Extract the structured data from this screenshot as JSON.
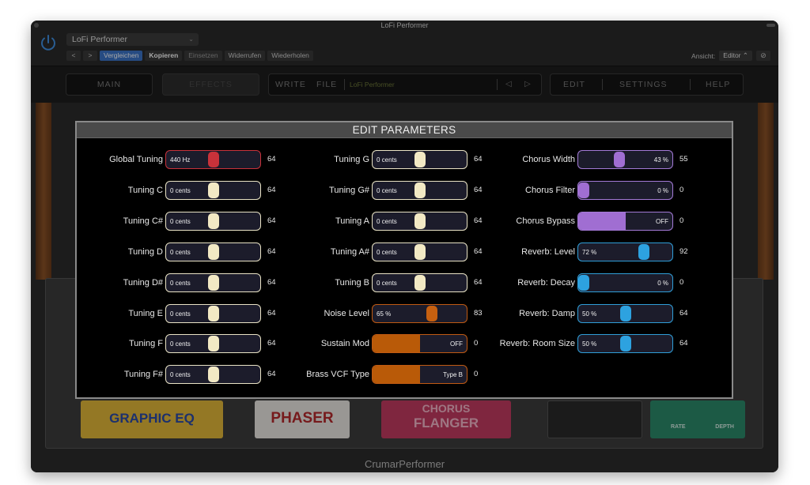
{
  "window": {
    "title": "LoFi Performer"
  },
  "host_toolbar": {
    "preset_name": "LoFi Performer",
    "prev_label": "<",
    "next_label": ">",
    "compare_label": "Vergleichen",
    "copy_label": "Kopieren",
    "paste_label": "Einsetzen",
    "undo_label": "Widerrufen",
    "redo_label": "Wiederholen",
    "view_label": "Ansicht:",
    "view_value": "Editor"
  },
  "plugin_nav": {
    "main": "MAIN",
    "effects": "EFFECTS",
    "write": "WRITE",
    "file": "FILE",
    "preset": "LoFi Performer",
    "edit": "EDIT",
    "settings": "SETTINGS",
    "help": "HELP"
  },
  "pedals": {
    "graphic_eq": "GRAPHIC EQ",
    "phaser": "PHASER",
    "chorus_flanger_1": "CHORUS",
    "chorus_flanger_2": "FLANGER",
    "rate": "RATE",
    "depth": "DEPTH"
  },
  "footer": {
    "brand": "CrumarPerformer"
  },
  "modal": {
    "title": "EDIT PARAMETERS",
    "columns": [
      [
        {
          "label": "Global Tuning",
          "display": "440 Hz",
          "value": "64",
          "level": 0.5,
          "color": "red"
        },
        {
          "label": "Tuning C",
          "display": "0 cents",
          "value": "64",
          "level": 0.5,
          "color": "cream"
        },
        {
          "label": "Tuning C#",
          "display": "0 cents",
          "value": "64",
          "level": 0.5,
          "color": "cream"
        },
        {
          "label": "Tuning D",
          "display": "0 cents",
          "value": "64",
          "level": 0.5,
          "color": "cream"
        },
        {
          "label": "Tuning D#",
          "display": "0 cents",
          "value": "64",
          "level": 0.5,
          "color": "cream"
        },
        {
          "label": "Tuning E",
          "display": "0 cents",
          "value": "64",
          "level": 0.5,
          "color": "cream"
        },
        {
          "label": "Tuning F",
          "display": "0 cents",
          "value": "64",
          "level": 0.5,
          "color": "cream"
        },
        {
          "label": "Tuning F#",
          "display": "0 cents",
          "value": "64",
          "level": 0.5,
          "color": "cream"
        }
      ],
      [
        {
          "label": "Tuning G",
          "display": "0 cents",
          "value": "64",
          "level": 0.5,
          "color": "cream"
        },
        {
          "label": "Tuning G#",
          "display": "0 cents",
          "value": "64",
          "level": 0.5,
          "color": "cream"
        },
        {
          "label": "Tuning A",
          "display": "0 cents",
          "value": "64",
          "level": 0.5,
          "color": "cream"
        },
        {
          "label": "Tuning A#",
          "display": "0 cents",
          "value": "64",
          "level": 0.5,
          "color": "cream"
        },
        {
          "label": "Tuning B",
          "display": "0 cents",
          "value": "64",
          "level": 0.5,
          "color": "cream"
        },
        {
          "label": "Noise Level",
          "display": "65 %",
          "value": "83",
          "level": 0.65,
          "color": "orange"
        },
        {
          "label": "Sustain Mod",
          "display": "OFF",
          "value": "0",
          "level": 0,
          "color": "orange",
          "toggle": true
        },
        {
          "label": "Brass VCF Type",
          "display": "Type B",
          "value": "0",
          "level": 0,
          "color": "orange",
          "toggle": true
        }
      ],
      [
        {
          "label": "Chorus Width",
          "display": "43 %",
          "value": "55",
          "level": 0.43,
          "color": "purple"
        },
        {
          "label": "Chorus Filter",
          "display": "0 %",
          "value": "0",
          "level": 0,
          "color": "purple"
        },
        {
          "label": "Chorus Bypass",
          "display": "OFF",
          "value": "0",
          "level": 0,
          "color": "purple",
          "toggle": true
        },
        {
          "label": "Reverb: Level",
          "display": "72 %",
          "value": "92",
          "level": 0.72,
          "color": "blue"
        },
        {
          "label": "Reverb: Decay",
          "display": "0 %",
          "value": "0",
          "level": 0,
          "color": "blue"
        },
        {
          "label": "Reverb: Damp",
          "display": "50 %",
          "value": "64",
          "level": 0.5,
          "color": "blue"
        },
        {
          "label": "Reverb: Room Size",
          "display": "50 %",
          "value": "64",
          "level": 0.5,
          "color": "blue"
        }
      ]
    ]
  }
}
